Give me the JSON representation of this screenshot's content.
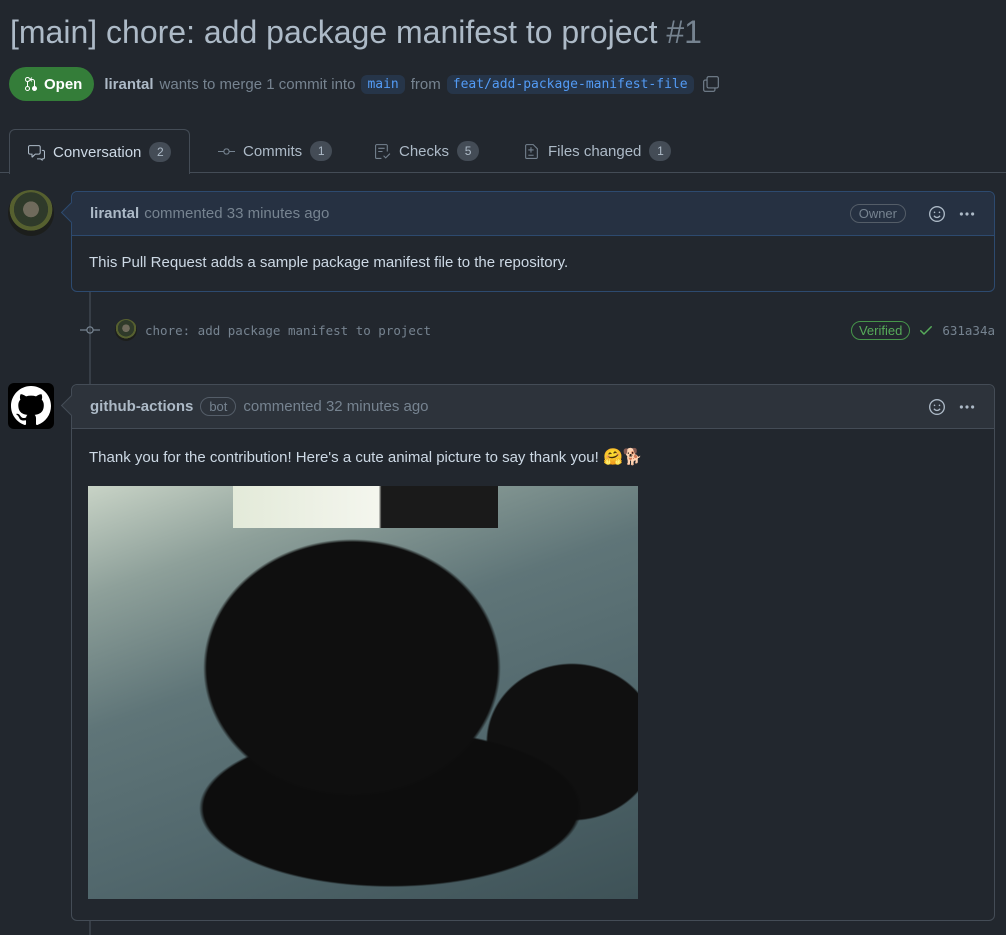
{
  "pr": {
    "title": "[main] chore: add package manifest to project",
    "number": "#1",
    "state": "Open",
    "author": "lirantal",
    "merge_text": "wants to merge 1 commit into",
    "base_branch": "main",
    "from_text": "from",
    "head_branch": "feat/add-package-manifest-file"
  },
  "tabs": [
    {
      "label": "Conversation",
      "count": "2",
      "icon": "comment-discussion-icon"
    },
    {
      "label": "Commits",
      "count": "1",
      "icon": "git-commit-icon"
    },
    {
      "label": "Checks",
      "count": "5",
      "icon": "checklist-icon"
    },
    {
      "label": "Files changed",
      "count": "1",
      "icon": "file-diff-icon"
    }
  ],
  "comment1": {
    "author": "lirantal",
    "action": "commented 33 minutes ago",
    "badge": "Owner",
    "body": "This Pull Request adds a sample package manifest file to the repository."
  },
  "commit": {
    "message": "chore: add package manifest to project",
    "verified": "Verified",
    "sha": "631a34a"
  },
  "comment2": {
    "author": "github-actions",
    "badge": "bot",
    "action": "commented 32 minutes ago",
    "body": "Thank you for the contribution! Here's a cute animal picture to say thank you!",
    "emojis": "🤗🐕"
  },
  "colors": {
    "background": "#22272e",
    "open_badge": "#347d39",
    "link": "#539bf5",
    "verified": "#57ab5a"
  }
}
